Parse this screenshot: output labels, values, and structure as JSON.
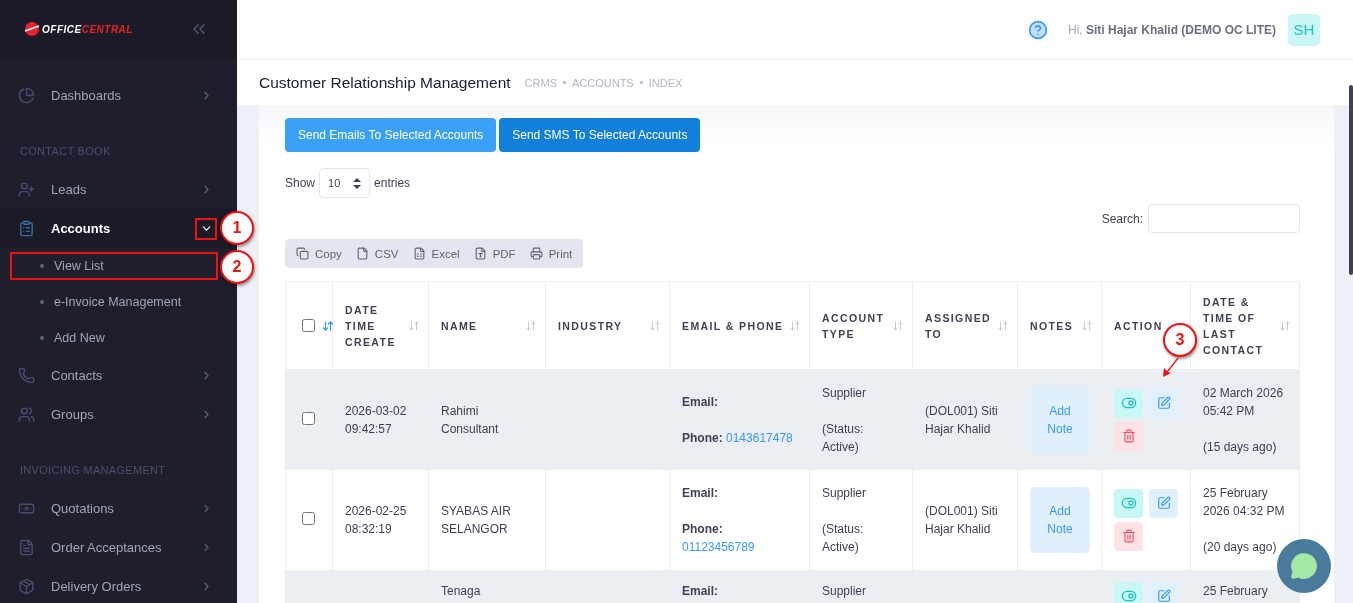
{
  "logo": {
    "primary": "OFFICE",
    "accent": "CENTRAL"
  },
  "sidebar": {
    "sections": [
      {
        "items": [
          {
            "label": "Dashboards",
            "selected": false,
            "expanded": false,
            "highlighted": false
          }
        ]
      },
      {
        "title": "CONTACT BOOK",
        "items": [
          {
            "label": "Leads",
            "selected": false,
            "expanded": false,
            "highlighted": false
          },
          {
            "label": "Accounts",
            "selected": true,
            "expanded": true,
            "highlighted": true,
            "children": [
              {
                "label": "View List",
                "highlighted": true
              },
              {
                "label": "e-Invoice Management",
                "highlighted": false
              },
              {
                "label": "Add New",
                "highlighted": false
              }
            ]
          },
          {
            "label": "Contacts",
            "selected": false,
            "expanded": false,
            "highlighted": false
          },
          {
            "label": "Groups",
            "selected": false,
            "expanded": false,
            "highlighted": false
          }
        ]
      },
      {
        "title": "INVOICING MANAGEMENT",
        "items": [
          {
            "label": "Quotations",
            "selected": false,
            "expanded": false,
            "highlighted": false
          },
          {
            "label": "Order Acceptances",
            "selected": false,
            "expanded": false,
            "highlighted": false
          },
          {
            "label": "Delivery Orders",
            "selected": false,
            "expanded": false,
            "highlighted": false
          }
        ]
      }
    ]
  },
  "header": {
    "greeting": "Hi, **Siti Hajar Khalid (DEMO OC LITE)**",
    "avatar": "SH"
  },
  "page": {
    "title": "Customer Relationship Management",
    "breadcrumbs": [
      "CRMS",
      "ACCOUNTS",
      "INDEX"
    ]
  },
  "actions": [
    "Send Emails To Selected Accounts",
    "Send SMS To Selected Accounts"
  ],
  "length_menu": {
    "before": "Show",
    "value": "10",
    "after": "entries"
  },
  "search": {
    "label": "Search:"
  },
  "export_buttons": [
    "Copy",
    "CSV",
    "Excel",
    "PDF",
    "Print"
  ],
  "table": {
    "columns": [
      {
        "kind": "check",
        "checked": false,
        "sorted": true
      },
      {
        "label": "DATE TIME CREATE",
        "kind": "sort",
        "sorted": false
      },
      {
        "label": "NAME",
        "kind": "sort",
        "sorted": false
      },
      {
        "label": "INDUSTRY",
        "kind": "sort",
        "sorted": false
      },
      {
        "label": "EMAIL & PHONE",
        "kind": "sort",
        "sorted": false
      },
      {
        "label": "ACCOUNT TYPE",
        "kind": "sort",
        "sorted": false
      },
      {
        "label": "ASSIGNED TO",
        "kind": "sort",
        "sorted": false
      },
      {
        "label": "NOTES",
        "kind": "sort",
        "sorted": false
      },
      {
        "label": "ACTION",
        "kind": "plain"
      },
      {
        "label": "DATE & TIME OF LAST CONTACT",
        "kind": "sort",
        "sorted": false
      }
    ],
    "rows": [
      {
        "checked": false,
        "created": "2026-03-02 09:42:57",
        "name": "Rahimi Consultant",
        "email_label": "Email:",
        "phone_label": "Phone:",
        "phone": "0143617478",
        "type": "Supplier",
        "status": "(Status: Active)",
        "assigned": "(DOL001) Siti Hajar Khalid",
        "note_button": "Add Note",
        "last_contact": "02 March 2026 05:42 PM",
        "ago": "(15 days ago)"
      },
      {
        "checked": false,
        "created": "2026-02-25 08:32:19",
        "name": "SYABAS AIR SELANGOR",
        "email_label": "Email:",
        "phone_label": "Phone:",
        "phone": "01123456789",
        "type": "Supplier",
        "status": "(Status: Active)",
        "assigned": "(DOL001) Siti Hajar Khalid",
        "note_button": "Add Note",
        "last_contact": "25 February 2026 04:32 PM",
        "ago": "(20 days ago)"
      },
      {
        "name": "Tenaga",
        "email_label": "Email:",
        "type": "Supplier",
        "last_contact": "25 February"
      }
    ]
  },
  "annotations": [
    {
      "label": "1"
    },
    {
      "label": "2"
    },
    {
      "label": "3"
    }
  ]
}
